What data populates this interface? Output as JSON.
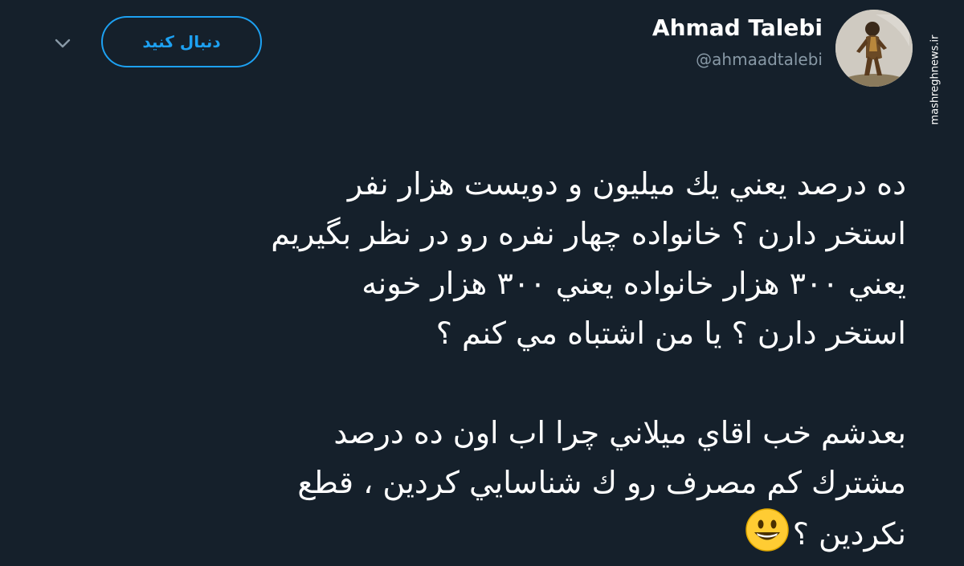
{
  "header": {
    "display_name": "Ahmad Talebi",
    "handle": "@ahmaadtalebi",
    "follow_label": "دنبال کنید",
    "menu_icon": "chevron-down-icon",
    "avatar_icon": "avatar-image"
  },
  "watermark": {
    "site": "mashreghnews.ir"
  },
  "tweet": {
    "lines": [
      "ده درصد يعني يك ميليون و دويست هزار نفر",
      "استخر دارن ؟ خانواده چهار نفره رو در نظر بگيريم",
      "يعني ۳۰۰ هزار خانواده يعني ۳۰۰ هزار خونه",
      "استخر دارن ؟ يا من اشتباه مي كنم ؟",
      "بعدشم خب اقاي ميلاني چرا اب اون ده درصد",
      "مشترك كم مصرف رو ك شناسايي كردين ، قطع",
      "نكردين ؟"
    ],
    "emoji_icon": "smiley-emoji-icon"
  },
  "colors": {
    "background": "#15202b",
    "accent": "#1da1f2",
    "secondary_text": "#8899a6",
    "text": "#ffffff"
  }
}
